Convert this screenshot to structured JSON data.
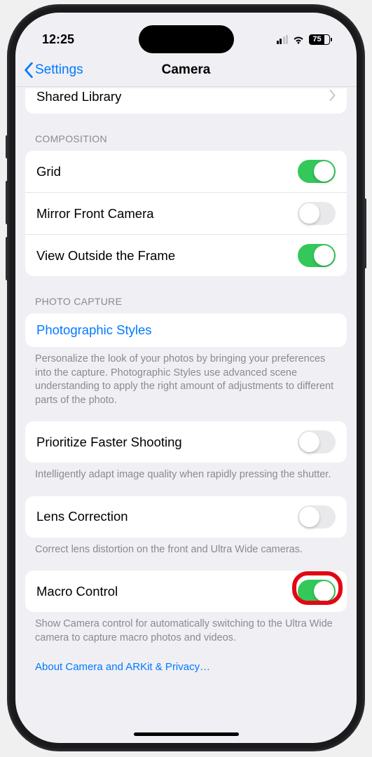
{
  "status": {
    "time": "12:25",
    "battery": "75"
  },
  "nav": {
    "back": "Settings",
    "title": "Camera"
  },
  "shared_library": {
    "label": "Shared Library"
  },
  "composition": {
    "header": "COMPOSITION",
    "grid": "Grid",
    "mirror": "Mirror Front Camera",
    "outside": "View Outside the Frame"
  },
  "photo_capture": {
    "header": "PHOTO CAPTURE",
    "styles": "Photographic Styles",
    "styles_footer": "Personalize the look of your photos by bringing your preferences into the capture. Photographic Styles use advanced scene understanding to apply the right amount of adjustments to different parts of the photo.",
    "prioritize": "Prioritize Faster Shooting",
    "prioritize_footer": "Intelligently adapt image quality when rapidly pressing the shutter.",
    "lens": "Lens Correction",
    "lens_footer": "Correct lens distortion on the front and Ultra Wide cameras.",
    "macro": "Macro Control",
    "macro_footer": "Show Camera control for automatically switching to the Ultra Wide camera to capture macro photos and videos."
  },
  "about": "About Camera and ARKit & Privacy…"
}
